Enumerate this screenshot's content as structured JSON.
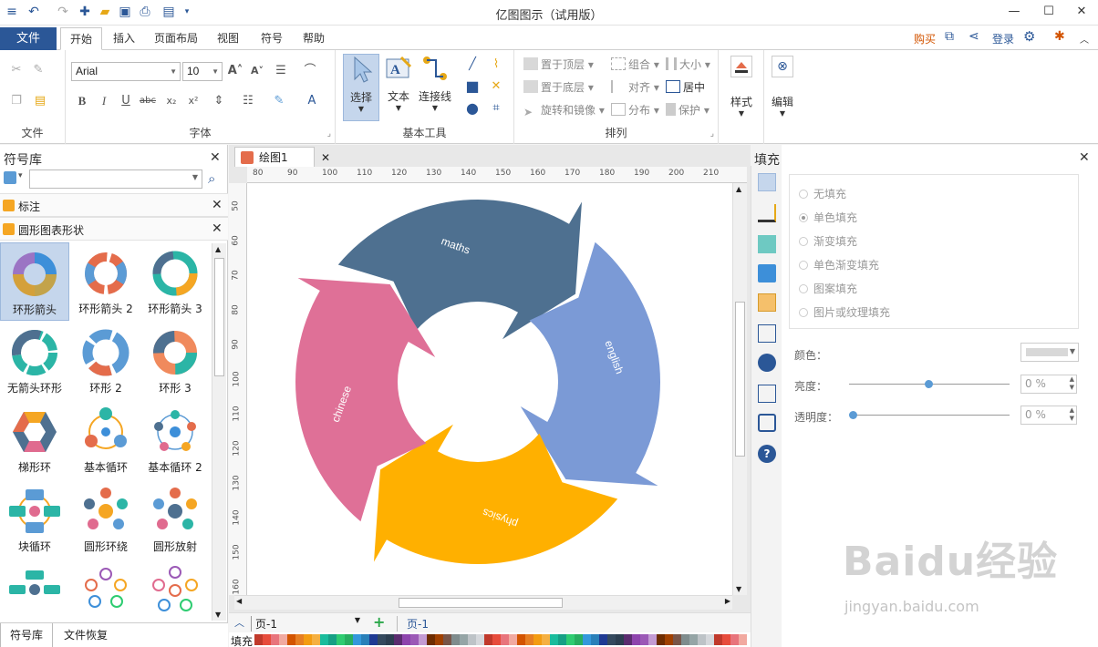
{
  "window": {
    "title": "亿图图示（试用版）"
  },
  "menu": {
    "file": "文件",
    "tabs": [
      "开始",
      "插入",
      "页面布局",
      "视图",
      "符号",
      "帮助"
    ],
    "right": {
      "buy": "购买",
      "login": "登录"
    }
  },
  "ribbon": {
    "groups": {
      "file": "文件",
      "font": "字体",
      "basic_tools": "基本工具",
      "arrange": "排列"
    },
    "font": {
      "name": "Arial",
      "size": "10"
    },
    "tools": {
      "select": "选择",
      "text": "文本",
      "connector": "连接线"
    },
    "arrange": {
      "bring_front": "置于顶层",
      "group": "组合",
      "size": "大小",
      "send_back": "置于底层",
      "align": "对齐",
      "center": "居中",
      "rotate_mirror": "旋转和镜像",
      "distribute": "分布",
      "protect": "保护"
    },
    "style": "样式",
    "edit": "编辑"
  },
  "library": {
    "title": "符号库",
    "sections": [
      "标注",
      "圆形图表形状"
    ],
    "shapes": [
      "环形箭头",
      "环形箭头 2",
      "环形箭头 3",
      "无箭头环形",
      "环形 2",
      "环形 3",
      "梯形环",
      "基本循环",
      "基本循环 2",
      "块循环",
      "圆形环绕",
      "圆形放射"
    ],
    "tabs": [
      "符号库",
      "文件恢复"
    ]
  },
  "document": {
    "tab": "绘图1",
    "ruler_h": [
      "80",
      "90",
      "100",
      "110",
      "120",
      "130",
      "140",
      "150",
      "160",
      "170",
      "180",
      "190",
      "200",
      "210"
    ],
    "ruler_v": [
      "50",
      "60",
      "70",
      "80",
      "90",
      "100",
      "110",
      "120",
      "130",
      "140",
      "150",
      "160"
    ],
    "page_select": "页-1",
    "page_tab": "页-1",
    "fill_label": "填充",
    "diagram": {
      "segments": [
        {
          "label": "maths",
          "color": "#4e7090"
        },
        {
          "label": "english",
          "color": "#7b9ad6"
        },
        {
          "label": "physics",
          "color": "#ffb000"
        },
        {
          "label": "chinese",
          "color": "#df7097"
        }
      ]
    }
  },
  "fill_panel": {
    "title": "填充",
    "options": [
      "无填充",
      "单色填充",
      "渐变填充",
      "单色渐变填充",
      "图案填充",
      "图片或纹理填充"
    ],
    "selected_option": "单色填充",
    "color_label": "颜色：",
    "brightness_label": "亮度：",
    "brightness_value": "0 %",
    "transparency_label": "透明度：",
    "transparency_value": "0 %"
  },
  "watermark": {
    "logo": "Baidu经验",
    "url": "jingyan.baidu.com"
  },
  "palette": [
    "#c0392b",
    "#e74c3c",
    "#e8747c",
    "#f1a9a0",
    "#d35400",
    "#e67e22",
    "#f39c12",
    "#f5b041",
    "#1abc9c",
    "#16a085",
    "#2ecc71",
    "#27ae60",
    "#3498db",
    "#2980b9",
    "#1f3a93",
    "#34495e",
    "#2c3e50",
    "#5b2c6f",
    "#8e44ad",
    "#9b59b6",
    "#c39bd3",
    "#6e2c00",
    "#a04000",
    "#795548",
    "#7f8c8d",
    "#95a5a6",
    "#bdc3c7",
    "#d5d8dc"
  ]
}
